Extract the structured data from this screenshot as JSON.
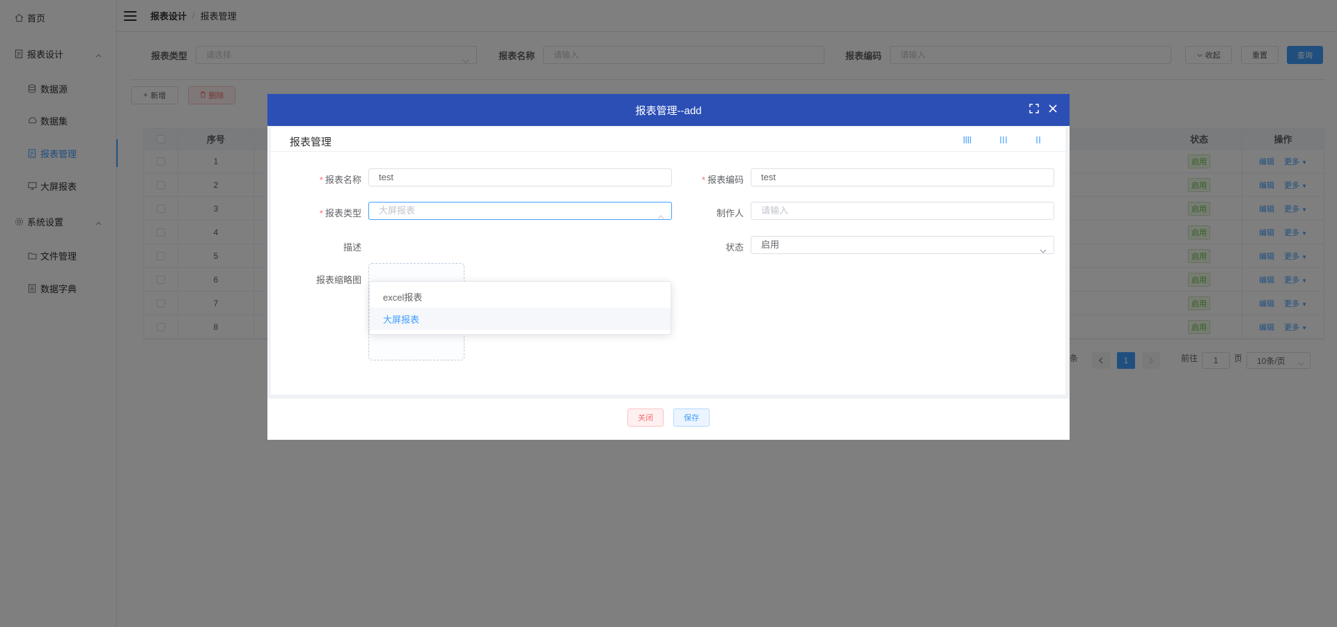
{
  "sidebar": {
    "items": [
      {
        "label": "首页"
      },
      {
        "label": "报表设计"
      },
      {
        "label": "数据源"
      },
      {
        "label": "数据集"
      },
      {
        "label": "报表管理"
      },
      {
        "label": "大屏报表"
      },
      {
        "label": "系统设置"
      },
      {
        "label": "文件管理"
      },
      {
        "label": "数据字典"
      }
    ]
  },
  "header": {
    "breadcrumb": [
      "报表设计",
      "报表管理"
    ],
    "separator": "/"
  },
  "search": {
    "type_label": "报表类型",
    "type_placeholder": "请选择",
    "name_label": "报表名称",
    "name_placeholder": "请输入",
    "code_label": "报表编码",
    "code_placeholder": "请输入",
    "collapse_label": "收起",
    "reset_label": "重置",
    "query_label": "查询"
  },
  "toolbar": {
    "add_label": "新增",
    "delete_label": "删除"
  },
  "table": {
    "headers": {
      "index": "序号",
      "status": "状态",
      "actions": "操作"
    },
    "rows": [
      {
        "index": "1",
        "status": "启用",
        "edit": "编辑",
        "more": "更多"
      },
      {
        "index": "2",
        "status": "启用",
        "edit": "编辑",
        "more": "更多"
      },
      {
        "index": "3",
        "status": "启用",
        "edit": "编辑",
        "more": "更多"
      },
      {
        "index": "4",
        "status": "启用",
        "edit": "编辑",
        "more": "更多"
      },
      {
        "index": "5",
        "status": "启用",
        "edit": "编辑",
        "more": "更多"
      },
      {
        "index": "6",
        "status": "启用",
        "edit": "编辑",
        "more": "更多"
      },
      {
        "index": "7",
        "status": "启用",
        "edit": "编辑",
        "more": "更多"
      },
      {
        "index": "8",
        "status": "启用",
        "edit": "编辑",
        "more": "更多"
      }
    ]
  },
  "pagination": {
    "total_suffix": "条",
    "current_page": "1",
    "goto_label": "前往",
    "goto_value": "1",
    "page_suffix": "页",
    "page_size": "10条/页"
  },
  "dialog": {
    "title": "报表管理--add",
    "panel_title": "报表管理",
    "fields": {
      "name_label": "报表名称",
      "name_value": "test",
      "code_label": "报表编码",
      "code_value": "test",
      "type_label": "报表类型",
      "type_placeholder": "大屏报表",
      "author_label": "制作人",
      "author_placeholder": "请输入",
      "desc_label": "描述",
      "status_label": "状态",
      "status_value": "启用",
      "thumb_label": "报表缩略图"
    },
    "dropdown_options": [
      "excel报表",
      "大屏报表"
    ],
    "close_label": "关闭",
    "save_label": "保存"
  },
  "colors": {
    "primary": "#409eff",
    "dialog_header": "#2c4fb5",
    "danger": "#f56c6c",
    "success": "#67c23a"
  }
}
